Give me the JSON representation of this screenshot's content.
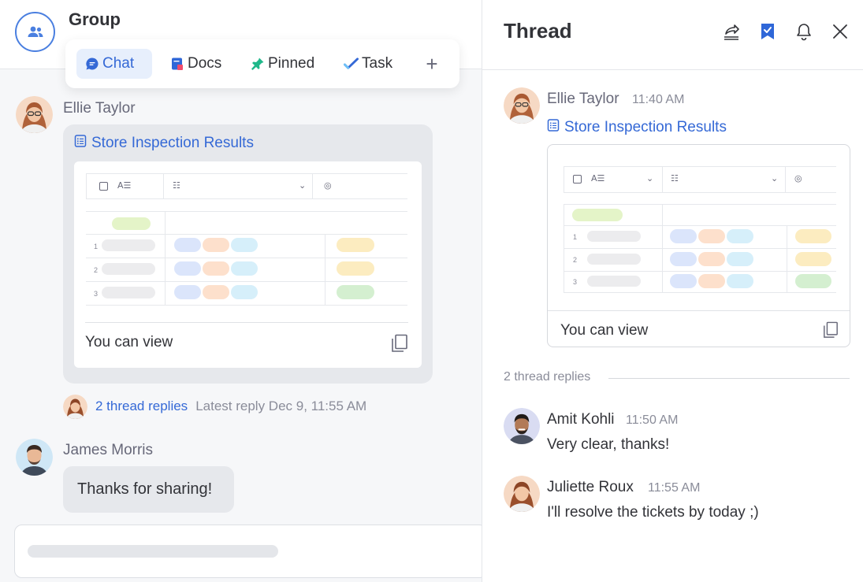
{
  "left": {
    "group_title": "Group",
    "tabs": [
      {
        "label": "Chat",
        "icon": "chat-bubble-icon",
        "active": true
      },
      {
        "label": "Docs",
        "icon": "docs-icon",
        "active": false
      },
      {
        "label": "Pinned",
        "icon": "pin-icon",
        "active": false
      },
      {
        "label": "Task",
        "icon": "check-icon",
        "active": false
      }
    ],
    "add_tab_label": "+",
    "message1": {
      "sender": "Ellie Taylor",
      "doc_title": "Store Inspection Results",
      "permission": "You can view",
      "thread_replies": "2 thread replies",
      "latest_reply": "Latest reply Dec 9, 11:55 AM"
    },
    "message2": {
      "sender": "James Morris",
      "text": "Thanks for sharing!"
    }
  },
  "right": {
    "title": "Thread",
    "header_icons": [
      "share-icon",
      "bookmark-icon",
      "bell-icon",
      "close-icon"
    ],
    "original": {
      "sender": "Ellie Taylor",
      "time": "11:40 AM",
      "doc_title": "Store Inspection Results",
      "permission": "You can view"
    },
    "replies_label": "2 thread replies",
    "replies": [
      {
        "sender": "Amit Kohli",
        "time": "11:50 AM",
        "text": "Very clear, thanks!"
      },
      {
        "sender": "Juliette Roux",
        "time": "11:55 AM",
        "text": "I'll resolve the tickets by today ;)"
      }
    ]
  },
  "table_preview": {
    "row_numbers": [
      "1",
      "2",
      "3"
    ]
  },
  "colors": {
    "accent": "#3569d6",
    "pill_blue": "#dbe5fb",
    "pill_orange": "#fde0cc",
    "pill_cyan": "#d6effa",
    "pill_yellow": "#fcecc0",
    "pill_green": "#d4efd0",
    "pill_lime": "#e4f4c8",
    "pill_grey": "#ececee"
  }
}
